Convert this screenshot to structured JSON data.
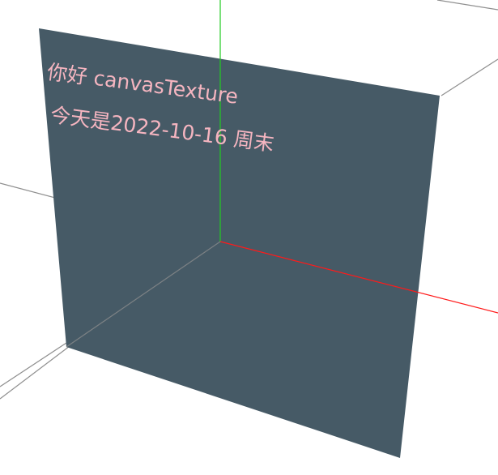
{
  "scene": {
    "colors": {
      "background": "#ffffff",
      "plane_fill": "#465a66",
      "text": "#f5b5c0",
      "axis_x": "#ff1a1a",
      "axis_y": "#22cc22",
      "grid": "#8f8f8f"
    },
    "plane": {
      "texture_lines": [
        "你好 canvasTexture",
        "今天是2022-10-16 周末"
      ]
    }
  }
}
